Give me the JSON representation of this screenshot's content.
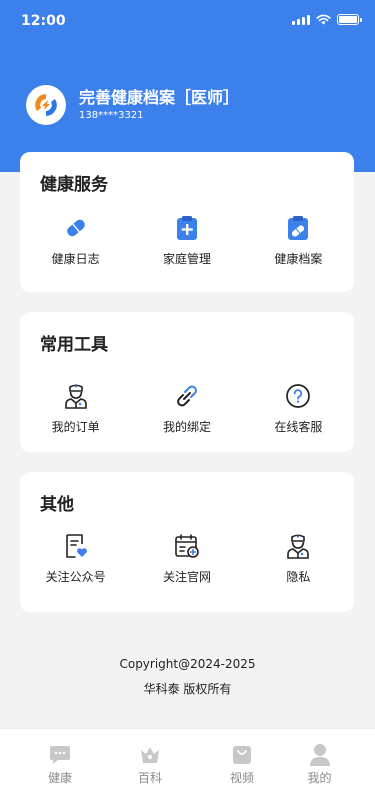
{
  "status_bar": {
    "time": "12:00"
  },
  "profile": {
    "title": "完善健康档案［医师］",
    "phone": "138****3321"
  },
  "health_services": {
    "title": "健康服务",
    "items": [
      {
        "label": "健康日志",
        "icon": "capsule-icon"
      },
      {
        "label": "家庭管理",
        "icon": "clipboard-plus-icon"
      },
      {
        "label": "健康档案",
        "icon": "clipboard-medical-icon"
      }
    ]
  },
  "tools": {
    "title": "常用工具",
    "items": [
      {
        "label": "我的订单",
        "icon": "doctor-icon"
      },
      {
        "label": "我的绑定",
        "icon": "link-icon"
      },
      {
        "label": "在线客服",
        "icon": "question-icon"
      }
    ]
  },
  "others": {
    "title": "其他",
    "items": [
      {
        "label": "关注公众号",
        "icon": "document-heart-icon"
      },
      {
        "label": "关注官网",
        "icon": "calendar-add-icon"
      },
      {
        "label": "隐私",
        "icon": "doctor-icon"
      }
    ]
  },
  "footer": {
    "copyright": "Copyright@2024-2025",
    "rights": "华科泰 版权所有"
  },
  "tabbar": [
    {
      "label": "健康",
      "icon": "chat-icon"
    },
    {
      "label": "百科",
      "icon": "crown-icon"
    },
    {
      "label": "视频",
      "icon": "bag-icon"
    },
    {
      "label": "我的",
      "icon": "person-icon"
    }
  ],
  "colors": {
    "primary": "#3c80ec",
    "background": "#f3f3f3",
    "tab_inactive": "#c8c8c8"
  }
}
